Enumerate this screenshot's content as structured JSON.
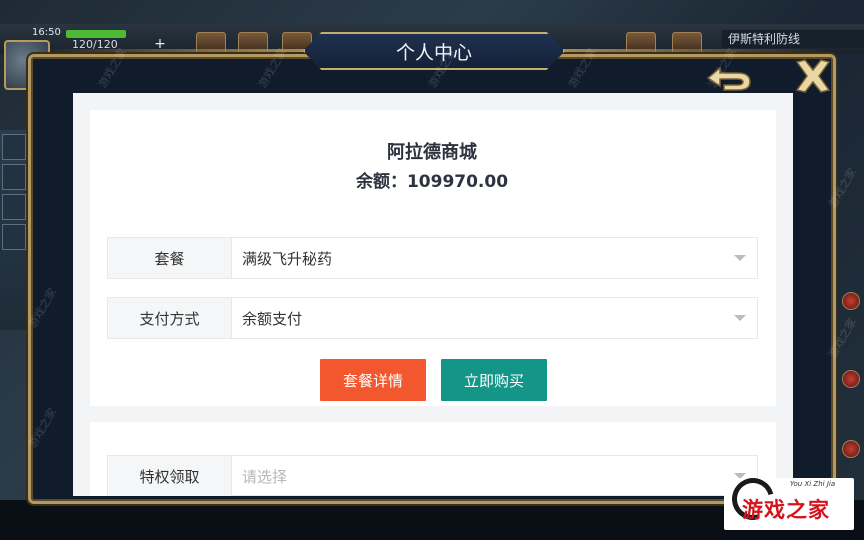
{
  "hud": {
    "time": "16:50",
    "energy": "120/120",
    "plus": "+",
    "right_text": "伊斯特利防线"
  },
  "dialog": {
    "title": "个人中心",
    "back_icon": "back-arrow-icon",
    "close_icon": "close-x-icon"
  },
  "shop": {
    "name": "阿拉德商城",
    "balance": "余额：109970.00"
  },
  "form": {
    "package_label": "套餐",
    "package_value": "满级飞升秘药",
    "payment_label": "支付方式",
    "payment_value": "余额支付",
    "privilege_label": "特权领取",
    "privilege_placeholder": "请选择"
  },
  "buttons": {
    "detail": "套餐详情",
    "buy": "立即购买"
  },
  "colors": {
    "detail_button": "#f2572d",
    "buy_button": "#139688",
    "frame_gold": "#b39a62",
    "dialog_bg": "#101b2c"
  },
  "watermark": {
    "text": "游戏之家",
    "small": "You Xi Zhi Jia",
    "diag": "游戏之家"
  }
}
